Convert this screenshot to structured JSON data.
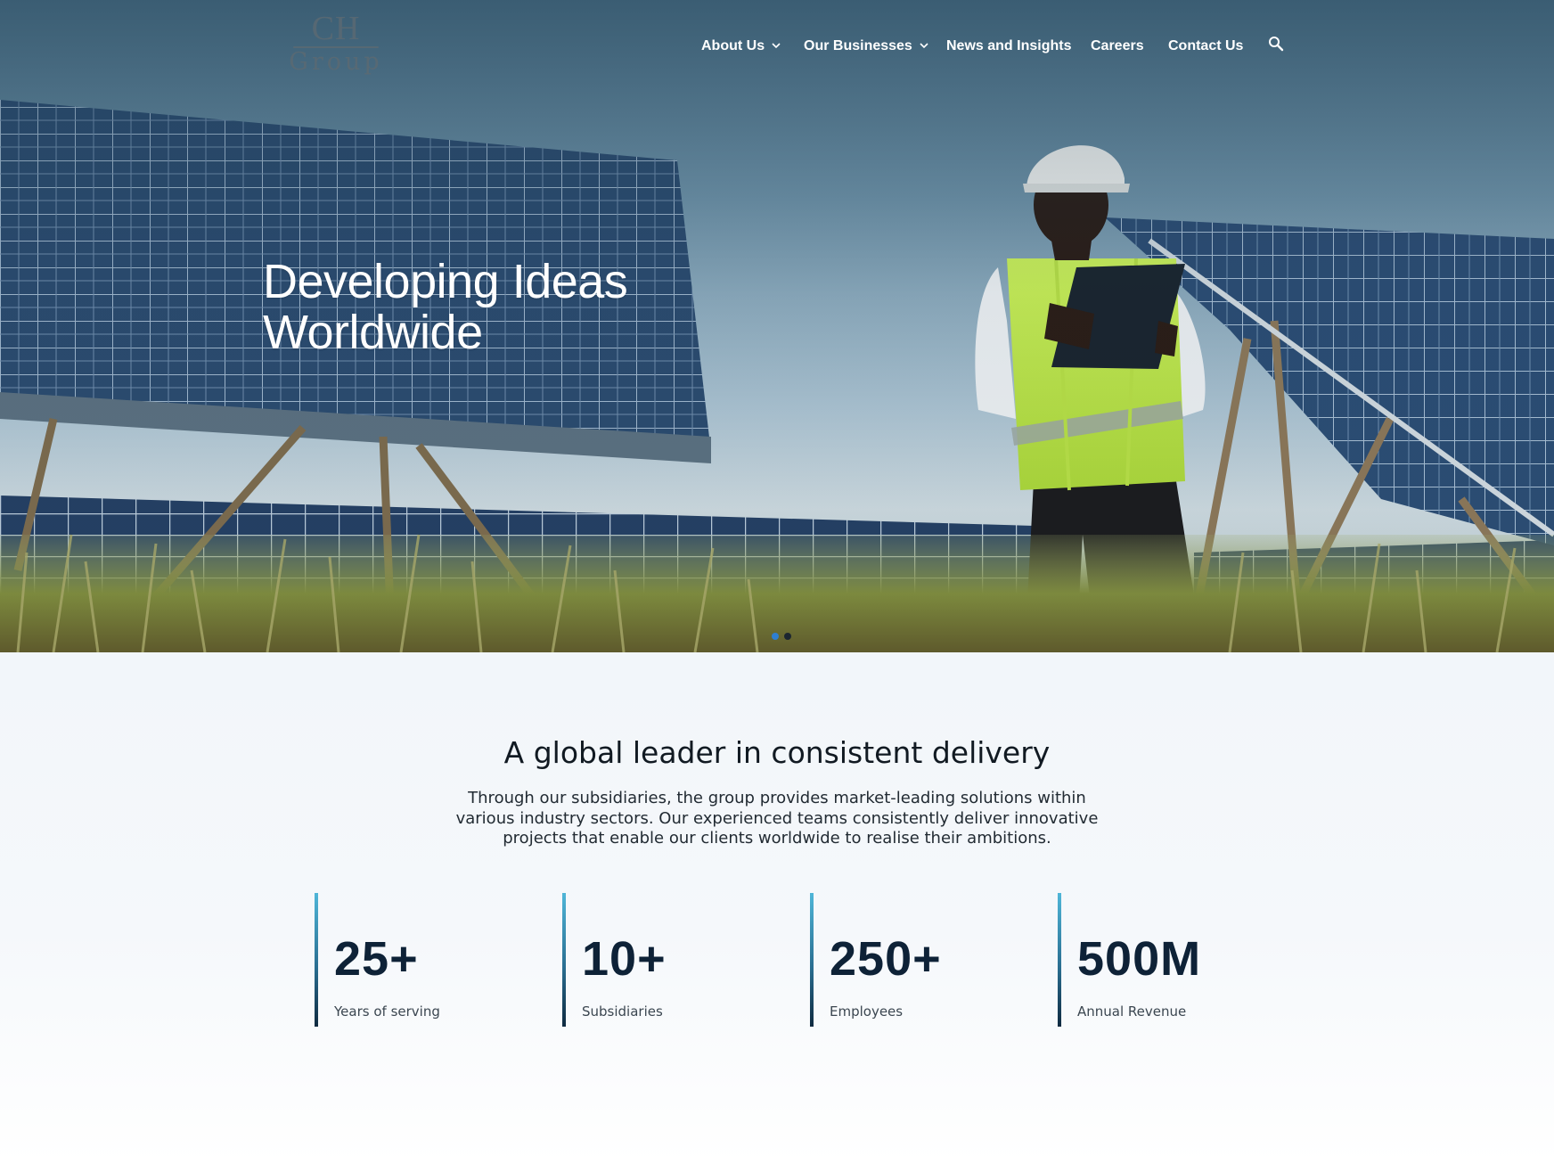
{
  "brand": {
    "logo_mark": "CH",
    "logo_word": "Group",
    "color_primary": "#0e2237",
    "color_accent": "#4fb6d8"
  },
  "nav": {
    "items": [
      {
        "label": "About Us",
        "has_dropdown": true,
        "icon": "chevron-down-icon"
      },
      {
        "label": "Our Businesses",
        "has_dropdown": true,
        "icon": "chevron-down-icon"
      },
      {
        "label": "News and Insights",
        "has_dropdown": false
      },
      {
        "label": "Careers",
        "has_dropdown": false
      },
      {
        "label": "Contact Us",
        "has_dropdown": false
      }
    ],
    "search_icon": "search-icon"
  },
  "hero": {
    "title_line1": "Developing Ideas",
    "title_line2": "Worldwide",
    "slider": {
      "slide_count": 2,
      "active_index": 0,
      "active_color": "#2e7fd1",
      "inactive_color": "#1c2630"
    }
  },
  "intro": {
    "heading": "A global leader in consistent delivery",
    "body_line1": "Through our subsidiaries, the group provides market-leading solutions within",
    "body_line2": "various industry sectors. Our experienced teams consistently deliver innovative",
    "body_line3": "projects that enable our clients worldwide to realise their ambitions."
  },
  "stats": [
    {
      "value": "25+",
      "label": "Years of serving"
    },
    {
      "value": "10+",
      "label": "Subsidiaries"
    },
    {
      "value": "250+",
      "label": "Employees"
    },
    {
      "value": "500M",
      "label": "Annual Revenue"
    }
  ]
}
